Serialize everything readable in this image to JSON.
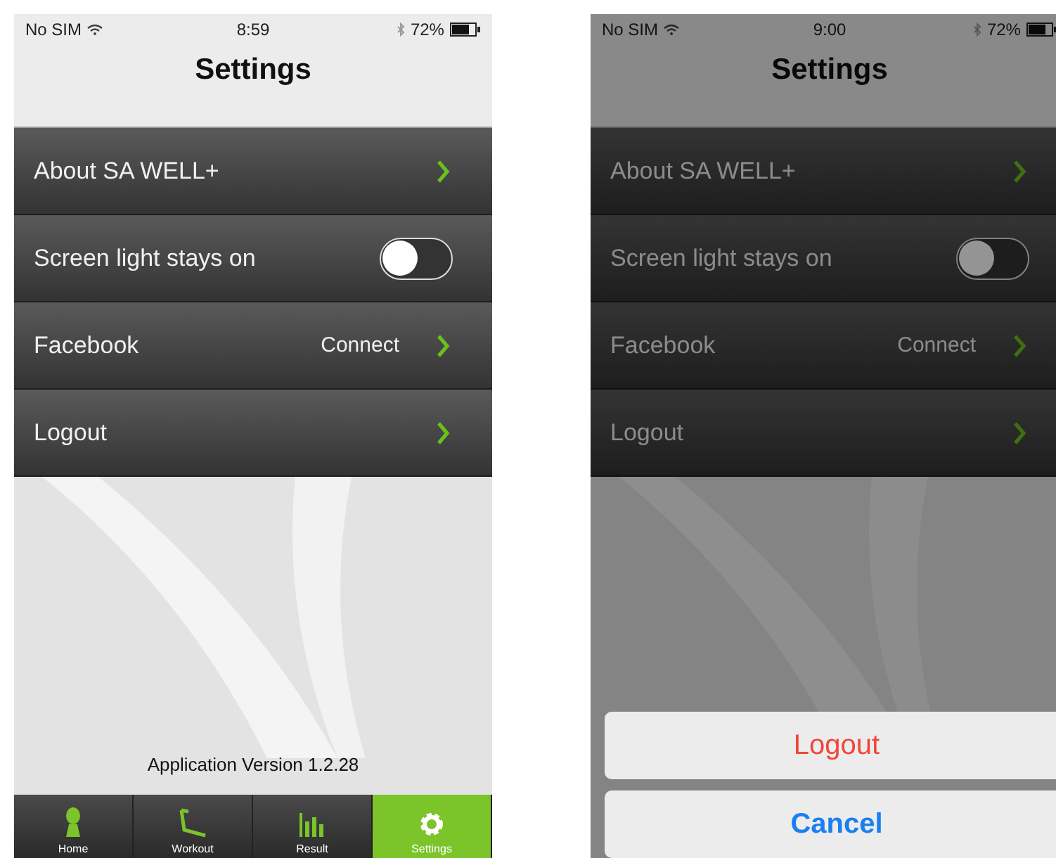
{
  "screens": [
    {
      "status_bar": {
        "carrier": "No SIM",
        "time": "8:59",
        "battery": "72%"
      },
      "title": "Settings",
      "dimmed": false,
      "rows": [
        {
          "kind": "link",
          "label": "About SA WELL+"
        },
        {
          "kind": "toggle",
          "label": "Screen light stays on",
          "on": false
        },
        {
          "kind": "link",
          "label": "Facebook",
          "value": "Connect"
        },
        {
          "kind": "link",
          "label": "Logout"
        }
      ],
      "version": "Application Version 1.2.28",
      "tabs": [
        {
          "label": "Home",
          "kind": "home",
          "selected": false
        },
        {
          "label": "Workout",
          "kind": "workout",
          "selected": false
        },
        {
          "label": "Result",
          "kind": "result",
          "selected": false
        },
        {
          "label": "Settings",
          "kind": "settings",
          "selected": true
        }
      ]
    },
    {
      "status_bar": {
        "carrier": "No SIM",
        "time": "9:00",
        "battery": "72%"
      },
      "title": "Settings",
      "dimmed": true,
      "rows": [
        {
          "kind": "link",
          "label": "About SA WELL+"
        },
        {
          "kind": "toggle",
          "label": "Screen light stays on",
          "on": false
        },
        {
          "kind": "link",
          "label": "Facebook",
          "value": "Connect"
        },
        {
          "kind": "link",
          "label": "Logout"
        }
      ],
      "action_sheet": [
        {
          "label": "Logout",
          "kind": "destructive"
        },
        {
          "label": "Cancel",
          "kind": "cancel"
        }
      ]
    }
  ]
}
